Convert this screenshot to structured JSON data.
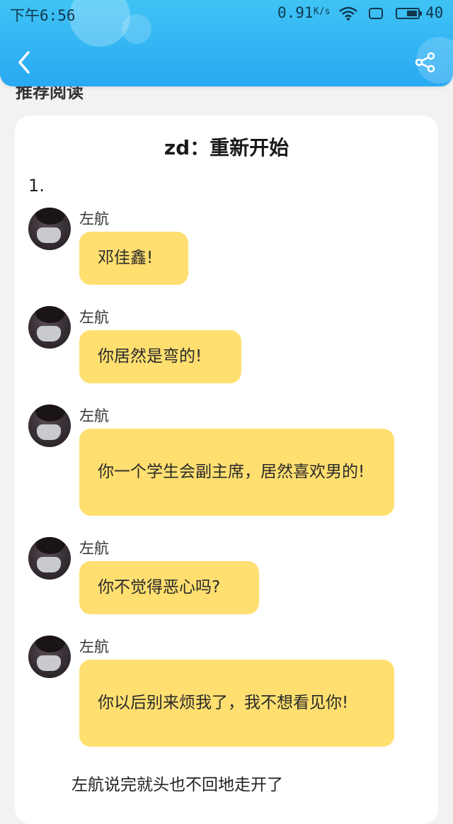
{
  "status_bar": {
    "time": "下午6:56",
    "speed": "0.91",
    "speed_unit": "K/s",
    "battery": "40"
  },
  "header": {
    "back_icon": "chevron-left-icon",
    "share_icon": "share-icon"
  },
  "section": {
    "title": "推荐阅读"
  },
  "story": {
    "title": "zd：重新开始",
    "chapter": "1.",
    "messages": [
      {
        "sender": "左航",
        "text": "邓佳鑫!"
      },
      {
        "sender": "左航",
        "text": "你居然是弯的!"
      },
      {
        "sender": "左航",
        "text": "你一个学生会副主席，居然喜欢男的!"
      },
      {
        "sender": "左航",
        "text": "你不觉得恶心吗?"
      },
      {
        "sender": "左航",
        "text": "你以后别来烦我了，我不想看见你!"
      }
    ],
    "narration": "左航说完就头也不回地走开了"
  },
  "colors": {
    "header_gradient_top": "#3fc3f5",
    "header_gradient_bottom": "#29a9f2",
    "bubble": "#ffdf70",
    "background": "#f2f2f2",
    "card": "#ffffff"
  }
}
